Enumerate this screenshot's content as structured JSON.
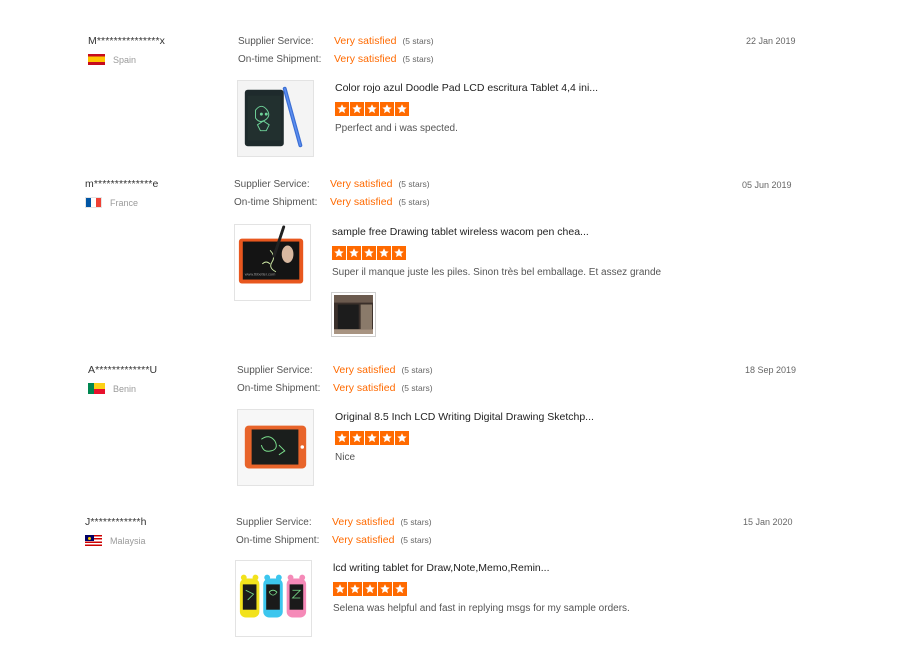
{
  "reviews": [
    {
      "name": "M***************x",
      "country": "Spain",
      "flag": "spain-flag-icon",
      "date": "22 Jan 2019",
      "supplier_service_label": "Supplier Service:",
      "supplier_service_value": "Very satisfied",
      "supplier_service_stars": "(5 stars)",
      "shipment_label": "On-time Shipment:",
      "shipment_value": "Very satisfied",
      "shipment_stars": "(5 stars)",
      "product_title": "Color rojo azul Doodle Pad LCD escritura Tablet 4,4 ini...",
      "rating": 5,
      "comment": "Pperfect and i was spected."
    },
    {
      "name": "m**************e",
      "country": "France",
      "flag": "france-flag-icon",
      "date": "05 Jun 2019",
      "supplier_service_label": "Supplier Service:",
      "supplier_service_value": "Very satisfied",
      "supplier_service_stars": "(5 stars)",
      "shipment_label": "On-time Shipment:",
      "shipment_value": "Very satisfied",
      "shipment_stars": "(5 stars)",
      "product_title": "sample free Drawing tablet wireless wacom pen chea...",
      "rating": 5,
      "comment": "Super il manque juste les piles. Sinon très bel emballage. Et assez grande"
    },
    {
      "name": "A*************U",
      "country": "Benin",
      "flag": "benin-flag-icon",
      "date": "18 Sep 2019",
      "supplier_service_label": "Supplier Service:",
      "supplier_service_value": "Very satisfied",
      "supplier_service_stars": "(5 stars)",
      "shipment_label": "On-time Shipment:",
      "shipment_value": "Very satisfied",
      "shipment_stars": "(5 stars)",
      "product_title": "Original 8.5 Inch LCD Writing Digital Drawing Sketchp...",
      "rating": 5,
      "comment": "Nice"
    },
    {
      "name": "J************h",
      "country": "Malaysia",
      "flag": "malaysia-flag-icon",
      "date": "15 Jan 2020",
      "supplier_service_label": "Supplier Service:",
      "supplier_service_value": "Very satisfied",
      "supplier_service_stars": "(5 stars)",
      "shipment_label": "On-time Shipment:",
      "shipment_value": "Very satisfied",
      "shipment_stars": "(5 stars)",
      "product_title": "lcd writing tablet for Draw,Note,Memo,Remin...",
      "rating": 5,
      "comment": "Selena was helpful and fast in replying msgs for my sample orders."
    }
  ],
  "thumbnail_watermark": "www.tbbetter.com",
  "colors": {
    "accent": "#ff6a00",
    "text": "#333333",
    "muted": "#9a9a9a"
  }
}
